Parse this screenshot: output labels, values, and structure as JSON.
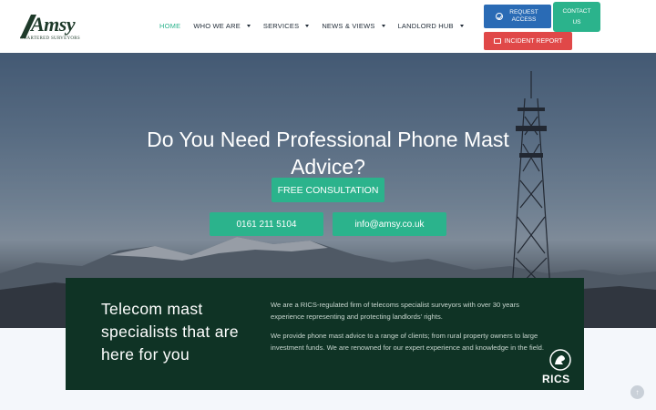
{
  "logo": {
    "name": "Amsy",
    "tagline": "CHARTERED SURVEYORS"
  },
  "nav": {
    "items": [
      {
        "label": "HOME",
        "active": true,
        "dropdown": false
      },
      {
        "label": "WHO WE ARE",
        "active": false,
        "dropdown": true
      },
      {
        "label": "SERVICES",
        "active": false,
        "dropdown": true
      },
      {
        "label": "NEWS & VIEWS",
        "active": false,
        "dropdown": true
      },
      {
        "label": "LANDLORD HUB",
        "active": false,
        "dropdown": true
      }
    ]
  },
  "header_buttons": {
    "request_access": "REQUEST ACCESS",
    "contact_us": "CONTACT US",
    "incident_report": "INCIDENT REPORT"
  },
  "hero": {
    "title": "Do You Need Professional Phone Mast Advice?",
    "cta": "FREE CONSULTATION",
    "phone": "0161 211 5104",
    "email": "info@amsy.co.uk"
  },
  "panel": {
    "heading": "Telecom mast specialists that are here for you",
    "paragraph_1": "We are a RICS-regulated firm of telecoms specialist surveyors with over 30 years experience  representing and protecting landlords' rights.",
    "paragraph_2": "We provide phone mast advice to a range of clients; from rural property owners to large investment funds. We are renowned for our expert experience and knowledge in the field.",
    "badge": "RICS"
  },
  "colors": {
    "accent_green": "#2bb38c",
    "dark_green": "#0f3325",
    "blue": "#2a6bb5",
    "red": "#e04848"
  },
  "icons": [
    "check-circle-icon",
    "monitor-icon",
    "caret-down-icon",
    "arrow-up-icon",
    "rics-lion-icon"
  ]
}
